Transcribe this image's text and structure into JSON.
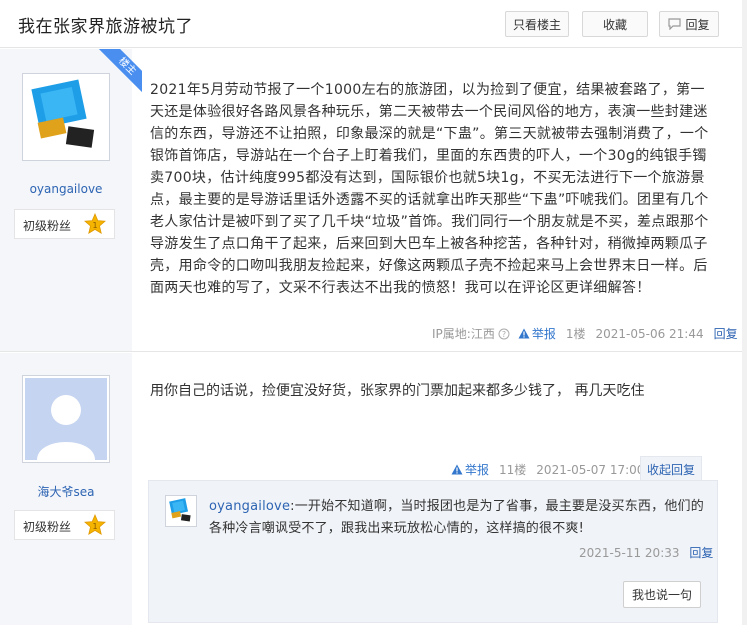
{
  "header": {
    "title": "我在张家界旅游被坑了",
    "only_op_label": "只看楼主",
    "favorite_label": "收藏",
    "reply_label": "回复"
  },
  "post1": {
    "corner_tag": "楼主",
    "username": "oyangailove",
    "level": "初级粉丝",
    "level_star": "1",
    "content": "2021年5月劳动节报了一个1000左右的旅游团，以为捡到了便宜，结果被套路了，第一天还是体验很好各路风景各种玩乐，第二天被带去一个民间风俗的地方，表演一些封建迷信的东西，导游还不让拍照，印象最深的就是“下蛊”。第三天就被带去强制消费了，一个银饰首饰店，导游站在一个台子上盯着我们，里面的东西贵的吓人，一个30g的纯银手镯卖700块，估计纯度995都没有达到，国际银价也就5块1g，不买无法进行下一个旅游景点，最主要的是导游话里话外透露不买的话就拿出昨天那些“下蛊”吓唬我们。团里有几个老人家估计是被吓到了买了几千块“垃圾”首饰。我们同行一个朋友就是不买，差点跟那个导游发生了点口角干了起来，后来回到大巴车上被各种挖苦，各种针对，稍微掉两颗瓜子壳，用命令的口吻叫我朋友捡起来，好像这两颗瓜子壳不捡起来马上会世界末日一样。后面两天也难的写了，文采不行表达不出我的愤怒！我可以在评论区更详细解答！",
    "ip_label": "IP属地:江西",
    "report_label": "举报",
    "floor": "1楼",
    "time": "2021-05-06 21:44",
    "reply_label": "回复"
  },
  "post2": {
    "username": "海大爷sea",
    "level": "初级粉丝",
    "level_star": "1",
    "content": "用你自己的话说，捡便宜没好货，张家界的门票加起来都多少钱了， 再几天吃住",
    "report_label": "举报",
    "floor": "11楼",
    "time": "2021-05-07 17:00",
    "collapse_label": "收起回复",
    "sub_reply": {
      "username": "oyangailove",
      "text": ":一开始不知道啊，当时报团也是为了省事，最主要是没买东西，他们的各种冷言嘲讽受不了，跟我出来玩放松心情的，这样搞的很不爽!",
      "time": "2021-5-11 20:33",
      "reply_label": "回复"
    },
    "say_label": "我也说一句"
  },
  "colors": {
    "link": "#2d64b3",
    "sidebar_bg": "#f4f6f9",
    "corner_tag_bg": "#4a8ff0",
    "star": "#f5b400"
  },
  "icons": [
    "speech-bubble-icon",
    "warning-icon",
    "help-circle-icon",
    "star-badge-icon"
  ]
}
